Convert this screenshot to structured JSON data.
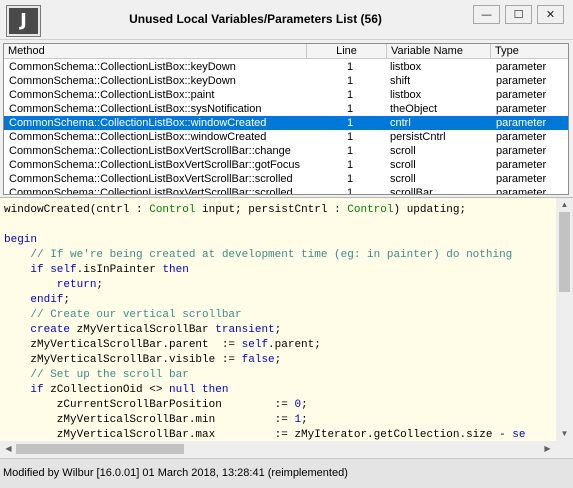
{
  "window": {
    "icon_letter": "J",
    "title": "Unused Local Variables/Parameters List (56)",
    "buttons": {
      "minimize": "—",
      "maximize": "☐",
      "close": "✕"
    }
  },
  "list": {
    "columns": [
      "Method",
      "Line",
      "Variable Name",
      "Type"
    ],
    "selected_index": 4,
    "rows": [
      {
        "method": "CommonSchema::CollectionListBox::keyDown",
        "line": "1",
        "variable": "listbox",
        "type": "parameter"
      },
      {
        "method": "CommonSchema::CollectionListBox::keyDown",
        "line": "1",
        "variable": "shift",
        "type": "parameter"
      },
      {
        "method": "CommonSchema::CollectionListBox::paint",
        "line": "1",
        "variable": "listbox",
        "type": "parameter"
      },
      {
        "method": "CommonSchema::CollectionListBox::sysNotification",
        "line": "1",
        "variable": "theObject",
        "type": "parameter"
      },
      {
        "method": "CommonSchema::CollectionListBox::windowCreated",
        "line": "1",
        "variable": "cntrl",
        "type": "parameter"
      },
      {
        "method": "CommonSchema::CollectionListBox::windowCreated",
        "line": "1",
        "variable": "persistCntrl",
        "type": "parameter"
      },
      {
        "method": "CommonSchema::CollectionListBoxVertScrollBar::change",
        "line": "1",
        "variable": "scroll",
        "type": "parameter"
      },
      {
        "method": "CommonSchema::CollectionListBoxVertScrollBar::gotFocus",
        "line": "1",
        "variable": "scroll",
        "type": "parameter"
      },
      {
        "method": "CommonSchema::CollectionListBoxVertScrollBar::scrolled",
        "line": "1",
        "variable": "scroll",
        "type": "parameter"
      },
      {
        "method": "CommonSchema::CollectionListBoxVertScrollBar::scrolled",
        "line": "1",
        "variable": "scrollBar",
        "type": "parameter"
      }
    ]
  },
  "code": {
    "lines": [
      [
        {
          "t": "tx",
          "s": "windowCreated(cntrl : "
        },
        {
          "t": "ty",
          "s": "Control"
        },
        {
          "t": "tx",
          "s": " input; persistCntrl : "
        },
        {
          "t": "ty",
          "s": "Control"
        },
        {
          "t": "tx",
          "s": ") updating;"
        }
      ],
      [],
      [
        {
          "t": "kw",
          "s": "begin"
        }
      ],
      [
        {
          "t": "cm",
          "s": "    // If we're being created at development time (eg: in painter) do nothing"
        }
      ],
      [
        {
          "t": "kw",
          "s": "    if self"
        },
        {
          "t": "tx",
          "s": ".isInPainter "
        },
        {
          "t": "kw",
          "s": "then"
        }
      ],
      [
        {
          "t": "kw",
          "s": "        return"
        },
        {
          "t": "tx",
          "s": ";"
        }
      ],
      [
        {
          "t": "kw",
          "s": "    endif"
        },
        {
          "t": "tx",
          "s": ";"
        }
      ],
      [
        {
          "t": "cm",
          "s": "    // Create our vertical scrollbar"
        }
      ],
      [
        {
          "t": "kw",
          "s": "    create"
        },
        {
          "t": "tx",
          "s": " zMyVerticalScrollBar "
        },
        {
          "t": "kw",
          "s": "transient"
        },
        {
          "t": "tx",
          "s": ";"
        }
      ],
      [
        {
          "t": "tx",
          "s": "    zMyVerticalScrollBar.parent  := "
        },
        {
          "t": "kw",
          "s": "self"
        },
        {
          "t": "tx",
          "s": ".parent;"
        }
      ],
      [
        {
          "t": "tx",
          "s": "    zMyVerticalScrollBar.visible := "
        },
        {
          "t": "kw",
          "s": "false"
        },
        {
          "t": "tx",
          "s": ";"
        }
      ],
      [
        {
          "t": "cm",
          "s": "    // Set up the scroll bar"
        }
      ],
      [
        {
          "t": "kw",
          "s": "    if"
        },
        {
          "t": "tx",
          "s": " zCollectionOid <> "
        },
        {
          "t": "kw",
          "s": "null then"
        }
      ],
      [
        {
          "t": "tx",
          "s": "        zCurrentScrollBarPosition        := "
        },
        {
          "t": "kw",
          "s": "0"
        },
        {
          "t": "tx",
          "s": ";"
        }
      ],
      [
        {
          "t": "tx",
          "s": "        zMyVerticalScrollBar.min         := "
        },
        {
          "t": "kw",
          "s": "1"
        },
        {
          "t": "tx",
          "s": ";"
        }
      ],
      [
        {
          "t": "tx",
          "s": "        zMyVerticalScrollBar.max         := zMyIterator.getCollection.size - "
        },
        {
          "t": "kw",
          "s": "se"
        }
      ]
    ]
  },
  "status": {
    "text": "Modified by Wilbur [16.0.01] 01 March 2018, 13:28:41 (reimplemented)"
  },
  "colors": {
    "selection": "#0078d7",
    "keyword": "#0000cc",
    "type": "#008000",
    "comment": "#3c8c8c",
    "code_background": "#fffde8"
  }
}
